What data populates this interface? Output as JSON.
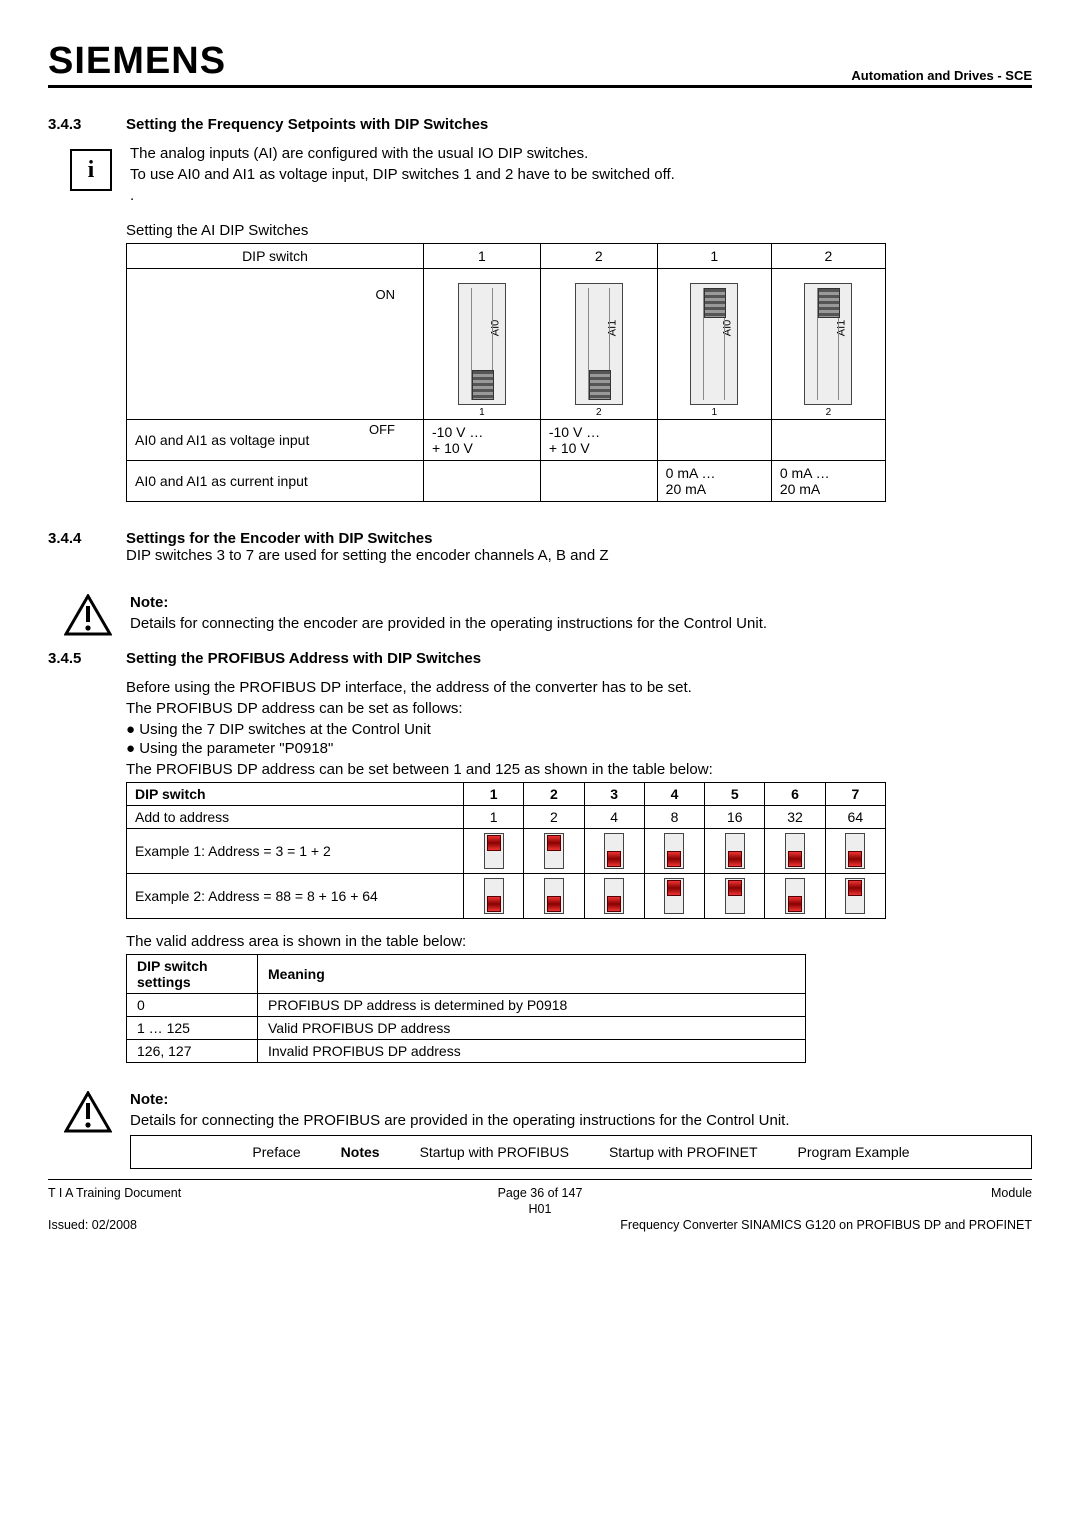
{
  "header": {
    "brand": "SIEMENS",
    "tagline": "Automation and Drives - SCE"
  },
  "s343": {
    "num": "3.4.3",
    "title": "Setting the Frequency Setpoints with DIP Switches",
    "p1": "The analog inputs  (AI) are configured with the usual IO DIP switches.",
    "p2": "To use AI0 and AI1 as voltage input,  DIP switches 1 and 2 have to be switched off.",
    "p3": ".",
    "caption": "Setting the AI DIP Switches",
    "table": {
      "head_row_label": "DIP switch",
      "cols": [
        "1",
        "2",
        "1",
        "2"
      ],
      "on": "ON",
      "off": "OFF",
      "sw_labels": [
        "AI0",
        "AI1",
        "AI0",
        "AI1"
      ],
      "sw_nums": [
        "1",
        "2",
        "1",
        "2"
      ],
      "sw_positions": [
        "down",
        "down",
        "up",
        "up"
      ],
      "row_voltage": {
        "label": "AI0 and AI1 as voltage input",
        "cells": [
          "-10 V …\n+ 10 V",
          "-10 V …\n+ 10 V",
          "",
          ""
        ]
      },
      "row_current": {
        "label": "AI0 and AI1 as current input",
        "cells": [
          "",
          "",
          "0 mA …\n20 mA",
          "0 mA …\n20 mA"
        ]
      }
    }
  },
  "s344": {
    "num": "3.4.4",
    "title": "Settings for the Encoder with DIP Switches",
    "p1": "DIP switches 3 to 7 are used for setting the encoder channels A, B and Z",
    "note_title": "Note:",
    "note_body": "Details for connecting the encoder are provided in the operating instructions for the Control Unit."
  },
  "s345": {
    "num": "3.4.5",
    "title": "Setting the PROFIBUS Address with DIP Switches",
    "p1": "Before using the PROFIBUS DP interface, the address of the converter has to be set.",
    "p2": "The PROFIBUS DP address can be set as follows:",
    "bullets": [
      "Using the 7 DIP switches at the Control Unit",
      "Using the parameter \"P0918\""
    ],
    "p3": "The PROFIBUS DP address can be set between 1 and 125 as shown in the table below:",
    "addr_table": {
      "head": [
        "DIP switch",
        "1",
        "2",
        "3",
        "4",
        "5",
        "6",
        "7"
      ],
      "add_row": [
        "Add to address",
        "1",
        "2",
        "4",
        "8",
        "16",
        "32",
        "64"
      ],
      "ex1_label": "Example 1: Address = 3 = 1 + 2",
      "ex1": [
        "up",
        "up",
        "down",
        "down",
        "down",
        "down",
        "down"
      ],
      "ex2_label": "Example 2: Address = 88 = 8 + 16 + 64",
      "ex2": [
        "down",
        "down",
        "down",
        "up",
        "up",
        "down",
        "up"
      ]
    },
    "p4": "The valid address area is shown in the table below:",
    "meaning_table": {
      "head": [
        "DIP switch settings",
        "Meaning"
      ],
      "rows": [
        [
          "0",
          "PROFIBUS DP address is determined by P0918"
        ],
        [
          "1 … 125",
          "Valid PROFIBUS DP address"
        ],
        [
          "126, 127",
          "Invalid PROFIBUS DP address"
        ]
      ]
    },
    "note_title": "Note:",
    "note_body": "Details for connecting the PROFIBUS are provided in the operating instructions for the Control Unit."
  },
  "nav": {
    "items": [
      "Preface",
      "Notes",
      "Startup with PROFIBUS",
      "Startup with PROFINET",
      "Program Example"
    ],
    "active": 1
  },
  "footer": {
    "l1": "T I A  Training Document",
    "c1": "Page 36 of 147",
    "r1": "Module",
    "c2": "H01",
    "l2": "Issued: 02/2008",
    "r2": "Frequency Converter SINAMICS G120 on PROFIBUS DP and PROFINET"
  }
}
